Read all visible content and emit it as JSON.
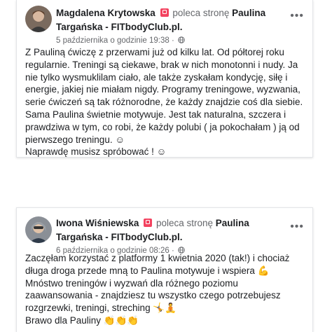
{
  "posts": [
    {
      "author": "Magdalena Krytowska",
      "verb": "poleca stronę",
      "page": "Paulina Targańska - FITbodyClub.pl",
      "page_suffix": ".",
      "date": "5 października o godzinie 19:38",
      "separator": "·",
      "body": [
        "Z Pauliną ćwiczę z przerwami już od kilku lat. Od półtorej roku regularnie. Treningi są ciekawe, brak w nich monotonni i nudy. Ja nie tylko wysmuklilam ciało, ale także zyskałam kondycję, siłę i energie, jakiej nie miałam nigdy. Programy treningowe, wyzwania, serie ćwiczeń są tak różnorodne, że każdy znajdzie coś dla siebie. Sama Paulina świetnie motywuje. Jest tak naturalna, szczera i prawdziwa w tym, co robi, że każdy polubi ( ja pokochałam ) ją od pierwszego treningu. ☺",
        "Naprawdę musisz spróbować ! ☺"
      ]
    },
    {
      "author": "Iwona Wiśniewska",
      "verb": "poleca stronę",
      "page": "Paulina Targańska - FITbodyClub.pl",
      "page_suffix": ".",
      "date": "6 października o godzinie 08:26",
      "separator": "·",
      "body": [
        "Zaczęłam korzystać z platformy 1 kwietnia 2020 (tak!) i chociaż długa droga przede mną to Paulina motywuje i wspiera 💪 Mnóstwo treningów i wyzwań dla różnego poziomu zaawansowania - znajdziesz tu wszystko czego potrzebujesz rozgrzewki, treningi, streching 🤸🧘",
        "Brawo dla Pauliny 👏👏👏"
      ]
    }
  ],
  "icons": {
    "recommend": "recommend-icon",
    "globe": "globe-icon",
    "menu": "more-options-icon"
  },
  "colors": {
    "recommend_red": "#f3425f",
    "secondary_text": "#65676b",
    "primary_text": "#1c1e21"
  }
}
